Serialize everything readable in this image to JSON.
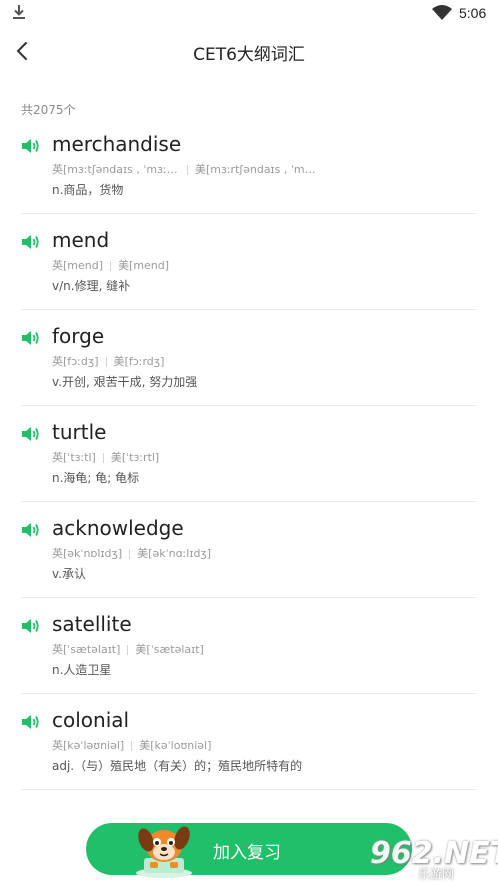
{
  "status_bar": {
    "time": "5:06",
    "icons": [
      "download-icon",
      "wifi-icon"
    ]
  },
  "header": {
    "title": "CET6大纲词汇",
    "back_icon": "chevron-left-icon"
  },
  "count_text": "共2075个",
  "accent_color": "#20c06a",
  "words": [
    {
      "word": "merchandise",
      "uk": "英[mɜːtʃəndaɪs , ˈmɜːtʃ…",
      "us": "美[mɜːrtʃəndaɪs , ˈmɜːr…",
      "def": "n.商品，货物"
    },
    {
      "word": "mend",
      "uk": "英[mend]",
      "us": "美[mend]",
      "def": "v/n.修理, 缝补"
    },
    {
      "word": "forge",
      "uk": "英[fɔːdʒ]",
      "us": "美[fɔːrdʒ]",
      "def": "v.开创, 艰苦干成, 努力加强"
    },
    {
      "word": "turtle",
      "uk": "英[ˈtɜːtl]",
      "us": "美[ˈtɜːrtl]",
      "def": "n.海龟; 龟; 龟标"
    },
    {
      "word": "acknowledge",
      "uk": "英[əkˈnɒlɪdʒ]",
      "us": "美[əkˈnɑːlɪdʒ]",
      "def": "v.承认"
    },
    {
      "word": "satellite",
      "uk": "英[ˈsætəlaɪt]",
      "us": "美[ˈsætəlaɪt]",
      "def": "n.人造卫星"
    },
    {
      "word": "colonial",
      "uk": "英[kəˈləʊniəl]",
      "us": "美[kəˈloʊniəl]",
      "def": "adj.（与）殖民地（有关）的；殖民地所特有的"
    }
  ],
  "review_button": {
    "label": "加入复习"
  },
  "watermark": {
    "text": "962.NET",
    "sub": "乐游网"
  }
}
